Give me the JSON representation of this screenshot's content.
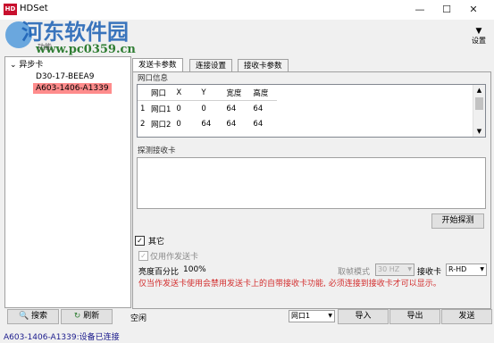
{
  "window": {
    "logo": "HD",
    "title": "HDSet"
  },
  "watermark": {
    "text": "河东软件园",
    "url": "www.pc0359.cn",
    "func_label": "功能"
  },
  "toolbar": {
    "settings_label": "设置"
  },
  "tree": {
    "root": "异步卡",
    "items": [
      "D30-17-BEEA9",
      "A603-1406-A1339"
    ],
    "selected_index": 1
  },
  "tabs": [
    "发送卡参数",
    "连接设置",
    "接收卡参数"
  ],
  "network_group": {
    "label": "网口信息",
    "columns": [
      "网口",
      "X",
      "Y",
      "宽度",
      "高度"
    ],
    "rows": [
      {
        "index": "1",
        "port": "网口1",
        "x": "0",
        "y": "0",
        "w": "64",
        "h": "64"
      },
      {
        "index": "2",
        "port": "网口2",
        "x": "0",
        "y": "64",
        "w": "64",
        "h": "64"
      }
    ]
  },
  "detect_group": {
    "label": "探测接收卡",
    "button": "开始探测"
  },
  "other": {
    "label": "其它",
    "checked": true,
    "only_send_label": "仅用作发送卡",
    "brightness_label": "亮度百分比",
    "brightness_value": "100%",
    "scan_mode_label": "取帧模式",
    "scan_mode_value": "30 HZ",
    "receiver_label": "接收卡",
    "receiver_value": "R-HD",
    "note": "仅当作发送卡使用会禁用发送卡上的自带接收卡功能, 必须连接到接收卡才可以显示。"
  },
  "bottom": {
    "search": "搜索",
    "refresh": "刷新",
    "status": "空闲",
    "port_select": "网口1",
    "import": "导入",
    "export": "导出",
    "send": "发送"
  },
  "statusbar": {
    "text": "A603-1406-A1339:设备已连接"
  },
  "colors": {
    "selected_bg": "#ff8c8c",
    "link_blue": "#1a5fb4",
    "warning_red": "#d32f2f"
  }
}
